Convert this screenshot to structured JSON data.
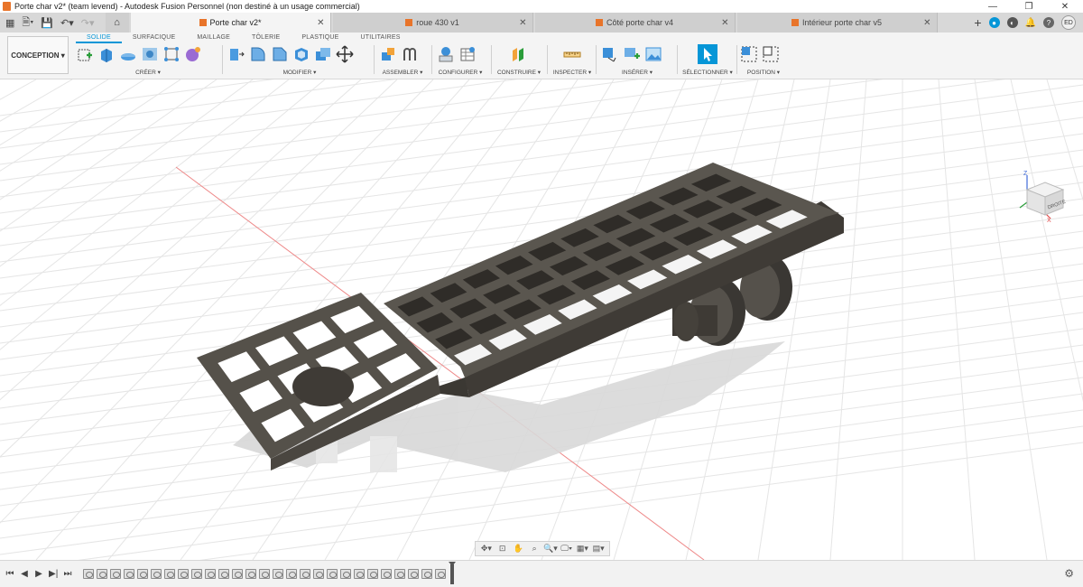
{
  "window": {
    "title": "Porte char v2* (team levend) - Autodesk Fusion Personnel (non destiné à un usage commercial)",
    "controls": [
      "—",
      "❐",
      "✕"
    ]
  },
  "tabs": [
    {
      "label": "Porte char v2*",
      "active": true
    },
    {
      "label": "roue 430 v1",
      "active": false
    },
    {
      "label": "Côté porte char v4",
      "active": false
    },
    {
      "label": "Intérieur porte char v5",
      "active": false
    }
  ],
  "user": {
    "initials": "ED"
  },
  "toolbar": {
    "workspace": "CONCEPTION ▾",
    "ribbon_tabs": [
      "SOLIDE",
      "SURFACIQUE",
      "MAILLAGE",
      "TÔLERIE",
      "PLASTIQUE",
      "UTILITAIRES"
    ],
    "groups": {
      "create": "CRÉER ▾",
      "modify": "MODIFIER ▾",
      "assemble": "ASSEMBLER ▾",
      "configure": "CONFIGURER ▾",
      "construct": "CONSTRUIRE ▾",
      "inspect": "INSPECTER ▾",
      "insert": "INSÉRER ▾",
      "select": "SÉLECTIONNER ▾",
      "position": "POSITION ▾"
    }
  },
  "viewcube": {
    "face_label": "DROITE",
    "axis_z": "Z",
    "axis_x": "X"
  },
  "colors": {
    "accent": "#0696d7",
    "model": "#4a4640",
    "grid": "#e3e3e3",
    "axis_red": "#e07070"
  }
}
